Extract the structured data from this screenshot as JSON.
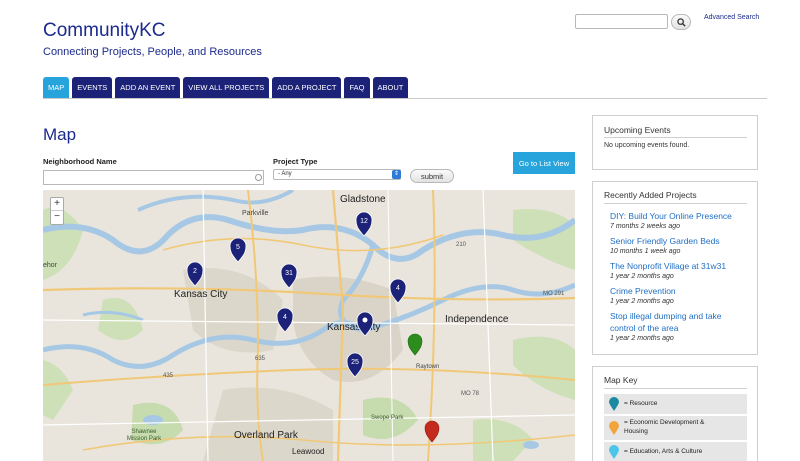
{
  "site": {
    "title": "CommunityKC",
    "tagline": "Connecting Projects, People, and Resources"
  },
  "search": {
    "value": "",
    "advanced_label": "Advanced Search"
  },
  "nav": {
    "tabs": [
      "MAP",
      "EVENTS",
      "ADD AN EVENT",
      "VIEW ALL PROJECTS",
      "ADD A PROJECT",
      "FAQ",
      "ABOUT"
    ],
    "active": "MAP"
  },
  "page": {
    "title": "Map"
  },
  "filters": {
    "neighborhood_label": "Neighborhood Name",
    "neighborhood_value": "",
    "project_type_label": "Project Type",
    "project_type_value": "- Any",
    "submit_label": "submit",
    "list_view_label": "Go to List View"
  },
  "map": {
    "zoom_in": "+",
    "zoom_out": "−",
    "place_labels": [
      {
        "name": "gladstone",
        "text": "Gladstone"
      },
      {
        "name": "parkville",
        "text": "Parkville"
      },
      {
        "name": "kansas-city-ks",
        "text": "Kansas City"
      },
      {
        "name": "kansas-city-mo",
        "text": "Kansas City"
      },
      {
        "name": "independence",
        "text": "Independence"
      },
      {
        "name": "overland-park",
        "text": "Overland Park"
      },
      {
        "name": "leawood",
        "text": "Leawood"
      },
      {
        "name": "swope-park",
        "text": "Swope Park"
      },
      {
        "name": "shawnee-mission-park",
        "text": "Shawnee\nMission Park"
      },
      {
        "name": "raytown",
        "text": "Raytown"
      },
      {
        "name": "edge-west",
        "text": "ehor"
      },
      {
        "name": "route-210",
        "text": "210"
      },
      {
        "name": "route-635",
        "text": "635"
      },
      {
        "name": "route-435",
        "text": "435"
      },
      {
        "name": "route-mo291",
        "text": "MO 291"
      },
      {
        "name": "route-mo78",
        "text": "MO 78"
      }
    ],
    "cluster_markers": [
      {
        "name": "cluster-12",
        "count": "12"
      },
      {
        "name": "cluster-5",
        "count": "5"
      },
      {
        "name": "cluster-2",
        "count": "2"
      },
      {
        "name": "cluster-31",
        "count": "31"
      },
      {
        "name": "cluster-4-east",
        "count": "4"
      },
      {
        "name": "cluster-4-west",
        "count": "4"
      },
      {
        "name": "cluster-single",
        "count": ""
      },
      {
        "name": "cluster-25",
        "count": "25"
      }
    ],
    "colors": {
      "water": "#a6c8e4",
      "park": "#c9dfb3",
      "urban": "#d7d2c5",
      "marker_cluster": "#1b2278",
      "marker_green": "#2c8c1e",
      "marker_red": "#c42a1e"
    }
  },
  "upcoming_events": {
    "title": "Upcoming Events",
    "empty_text": "No upcoming events found."
  },
  "recent_projects": {
    "title": "Recently Added Projects",
    "items": [
      {
        "title": "DIY: Build Your Online Presence",
        "age": "7 months 2 weeks ago"
      },
      {
        "title": "Senior Friendly Garden Beds",
        "age": "10 months 1 week ago"
      },
      {
        "title": "The Nonprofit Village at 31w31",
        "age": "1 year 2 months ago"
      },
      {
        "title": "Crime Prevention",
        "age": "1 year 2 months ago"
      },
      {
        "title": "Stop illegal dumping and take",
        "title2": "control of the area",
        "age": "1 year 2 months ago"
      }
    ]
  },
  "map_key": {
    "title": "Map Key",
    "items": [
      {
        "label": "= Resource",
        "color": "#1d8aa0"
      },
      {
        "label": "= Economic Development &",
        "label2": "Housing",
        "color": "#f2a33a"
      },
      {
        "label": "= Education, Arts & Culture",
        "color": "#4cc6e8"
      }
    ]
  }
}
